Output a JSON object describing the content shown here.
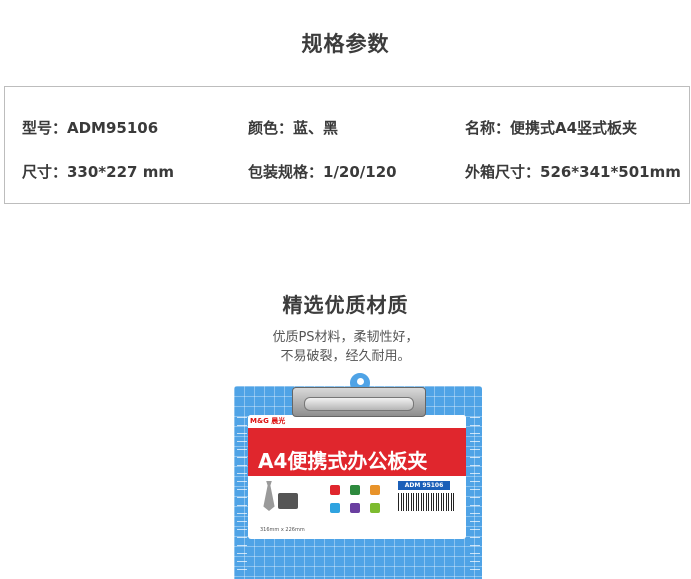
{
  "spec": {
    "title": "规格参数",
    "model": "型号：ADM95106",
    "color": "颜色：蓝、黑",
    "name": "名称：便携式A4竖式板夹",
    "size": "尺寸：330*227 mm",
    "packing": "包装规格：1/20/120",
    "outer_box": "外箱尺寸：526*341*501mm"
  },
  "material": {
    "title": "精选优质材质",
    "line1": "优质PS材料，柔韧性好，",
    "line2": "不易破裂，经久耐用。"
  },
  "product": {
    "brand": "M&G 晨光",
    "band_text": "A4便携式办公板夹",
    "model_tag": "ADM 95106",
    "dims": "316mm x 226mm"
  },
  "colors": {
    "board": "#4fa3e6",
    "red": "#e0262d"
  }
}
